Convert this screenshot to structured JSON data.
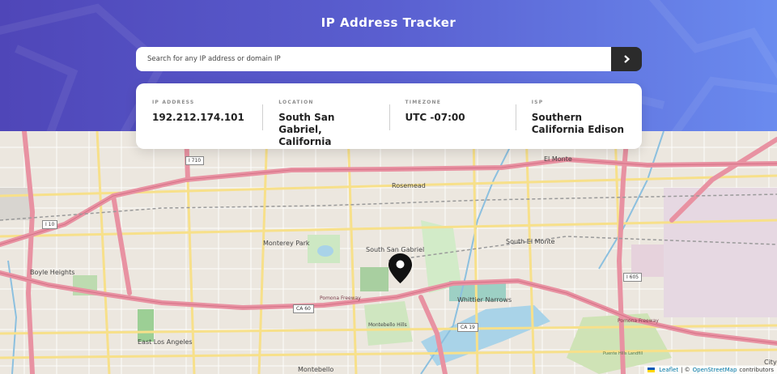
{
  "header": {
    "title": "IP Address Tracker",
    "search_placeholder": "Search for any IP address or domain IP",
    "submit_icon": "chevron-right-icon"
  },
  "info": [
    {
      "label": "IP ADDRESS",
      "value": "192.212.174.101"
    },
    {
      "label": "LOCATION",
      "value": "South San Gabriel, California"
    },
    {
      "label": "TIMEZONE",
      "value": "UTC -07:00"
    },
    {
      "label": "ISP",
      "value": "Southern California Edison"
    }
  ],
  "map": {
    "marker_icon": "location-pin-icon",
    "places": [
      {
        "name": "El Monte"
      },
      {
        "name": "Rosemead"
      },
      {
        "name": "Monterey Park"
      },
      {
        "name": "South San Gabriel"
      },
      {
        "name": "South El Monte"
      },
      {
        "name": "Boyle Heights"
      },
      {
        "name": "Whittier Narrows"
      },
      {
        "name": "Montebello Hills"
      },
      {
        "name": "East Los Angeles"
      },
      {
        "name": "Montebello"
      },
      {
        "name": "Puente Hills Landfill"
      },
      {
        "name": "City"
      }
    ],
    "shields": [
      "I 710",
      "I 605",
      "CA 60",
      "CA 19",
      "I 10"
    ],
    "roads": [
      "Pomona Freeway",
      "Pomona Freeway"
    ],
    "attribution": {
      "leaflet": "Leaflet",
      "separator": "| ©",
      "osm": "OpenStreetMap",
      "contributors": "contributors"
    }
  },
  "colors": {
    "header_start": "#4f46b8",
    "header_end": "#6a8bef",
    "button": "#2b2b2b",
    "freeway": "#e892a2",
    "arterial": "#f7e08a"
  }
}
